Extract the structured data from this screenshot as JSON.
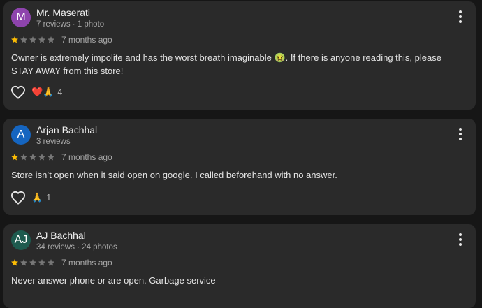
{
  "reviews": [
    {
      "avatar_letter": "M",
      "avatar_color": "#8e44ad",
      "name": "Mr. Maserati",
      "meta": "7 reviews · 1 photo",
      "rating": 1,
      "time": "7 months ago",
      "text": "Owner is extremely impolite and has the worst breath imaginable 🤢. If there is anyone reading this, please STAY AWAY from this store!",
      "reactions_emoji": "❤️🙏",
      "reaction_count": "4"
    },
    {
      "avatar_letter": "A",
      "avatar_color": "#1565c0",
      "name": "Arjan Bachhal",
      "meta": "3 reviews",
      "rating": 1,
      "time": "7 months ago",
      "text": "Store isn’t open when it said open on google. I called beforehand with no answer.",
      "reactions_emoji": "🙏",
      "reaction_count": "1"
    },
    {
      "avatar_letter": "AJ",
      "avatar_color": "#1e5b4f",
      "name": "AJ Bachhal",
      "meta": "34 reviews · 24 photos",
      "rating": 1,
      "time": "7 months ago",
      "text": "Never answer phone or are open. Garbage service"
    }
  ],
  "colors": {
    "star_filled": "#fbbc04",
    "star_empty": "#777777"
  }
}
